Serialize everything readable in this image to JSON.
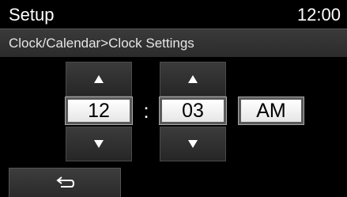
{
  "header": {
    "title": "Setup",
    "clock": "12:00"
  },
  "breadcrumb": "Clock/Calendar>Clock Settings",
  "time": {
    "hour": "12",
    "separator": ":",
    "minute": "03",
    "period": "AM"
  },
  "icons": {
    "hour_up": "triangle-up-icon",
    "hour_down": "triangle-down-icon",
    "minute_up": "triangle-up-icon",
    "minute_down": "triangle-down-icon",
    "back": "return-arrow-icon"
  }
}
